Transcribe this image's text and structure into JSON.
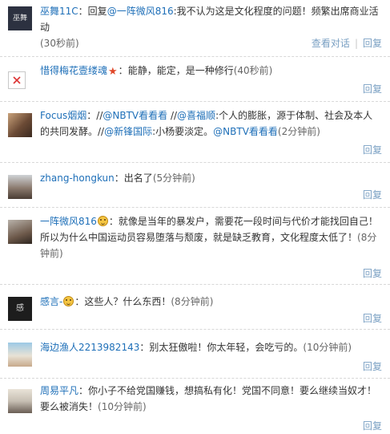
{
  "actions": {
    "view_conversation": "查看对话",
    "reply": "回复"
  },
  "comments": [
    {
      "avatar_icon": "dark-square-avatar",
      "name": "巫舞11C",
      "sep": "：",
      "text_a": "回复",
      "mention": "@一阵微风816",
      "text_b": ":我不认为这是文化程度的问题！频繁出席商业活动",
      "time": "(30秒前)"
    },
    {
      "avatar_icon": "broken-image-avatar",
      "name": "惜得梅花壹缕魂",
      "emoticon": "star-emoticon",
      "sep": "：",
      "text_a": "能静，能定，是一种修行",
      "time": "(40秒前)"
    },
    {
      "avatar_icon": "person-avatar",
      "name": "Focus烟烟",
      "sep": "：",
      "text_a": "//",
      "m1": "@NBTV看看看",
      "t2": " //",
      "m2": "@喜福顺",
      "t3": ":个人的膨胀，源于体制、社会及本人的共同发酵。//",
      "m3": "@新锋国际",
      "t4": ":小杨要淡定。",
      "m4": "@NBTV看看看",
      "time": "(2分钟前)"
    },
    {
      "avatar_icon": "person-avatar",
      "name": "zhang-hongkun",
      "sep": "：",
      "text_a": "出名了",
      "time": "(5分钟前)"
    },
    {
      "avatar_icon": "person-avatar",
      "name": "一阵微风816",
      "emoticon": "smile-emoticon",
      "sep": "：",
      "text_a": "就像是当年的暴发户，需要花一段时间与代价才能找回自己！所以为什么中国运动员容易堕落与颓废，就是缺乏教育，文化程度太低了！",
      "time": "(8分钟前)"
    },
    {
      "avatar_icon": "text-avatar",
      "name": "感言-",
      "emoticon": "smile-emoticon",
      "sep": "：",
      "text_a": "这些人？什么东西！",
      "time": "(8分钟前)"
    },
    {
      "avatar_icon": "group-photo-avatar",
      "name": "海边渔人2213982143",
      "sep": "：",
      "text_a": "别太狂傲啦！你太年轻，会吃亏的。",
      "time": "(10分钟前)"
    },
    {
      "avatar_icon": "person-avatar",
      "name": "周易平凡",
      "sep": "：",
      "text_a": "你小子不给党国赚钱，想搞私有化！党国不同意！要么继续当奴才！要么被消失！",
      "time": "(10分钟前)"
    }
  ],
  "avatar_texts": {
    "c1": "巫舞",
    "c6": "感"
  }
}
